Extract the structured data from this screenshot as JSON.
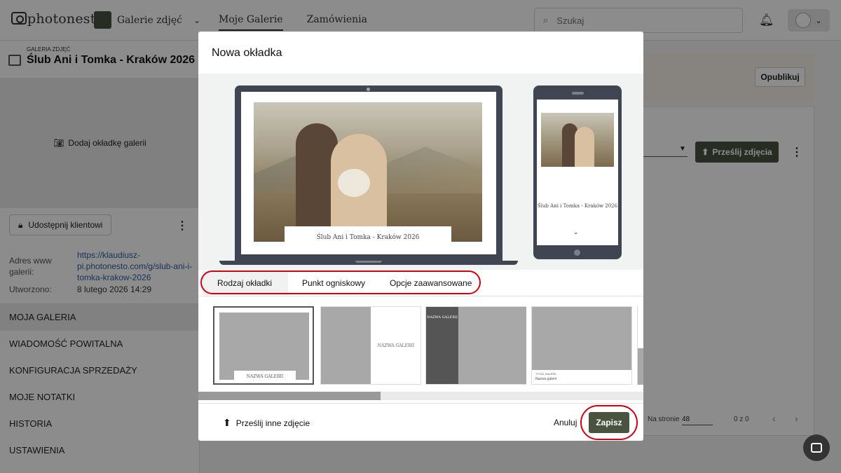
{
  "app": {
    "logo_text": "photonesto",
    "gallery_switch_label": "Galerie zdjęć",
    "nav": [
      "Moje Galerie",
      "Zamówienia"
    ],
    "search_placeholder": "Szukaj"
  },
  "sidebar": {
    "eyebrow": "GALERIA ZDJĘĆ",
    "title": "Ślub Ani i Tomka - Kraków 2026",
    "add_cover_label": "Dodaj okładkę galerii",
    "share_label": "Udostępnij klientowi",
    "address_label": "Adres www galerii:",
    "address_value": "https://klaudiusz-pi.photonesto.com/g/slub-ani-i-tomka-krakow-2026",
    "created_label": "Utworzono:",
    "created_value": "8 lutego 2026 14:29",
    "menu": [
      "MOJA GALERIA",
      "WIADOMOŚĆ POWITALNA",
      "KONFIGURACJA SPRZEDAŻY",
      "MOJE NOTATKI",
      "HISTORIA",
      "USTAWIENIA"
    ]
  },
  "content": {
    "publish_label": "Opublikuj",
    "upload_label": "Prześlij zdjęcia",
    "per_page_label": "Na stronie",
    "per_page_value": "48",
    "count_label": "0 z 0"
  },
  "modal": {
    "title": "Nowa okładka",
    "cover_caption": "Ślub Ani i Tomka - Kraków 2026",
    "tabs": [
      "Rodzaj okładki",
      "Punkt ogniskowy",
      "Opcje zaawansowane"
    ],
    "thumb_label": "NAZWA GALERII",
    "thumb_small_label": "TYTUŁ GALERII",
    "thumb_small_name": "Nazwa galerii",
    "upload_other_label": "Prześlij inne zdjęcie",
    "cancel_label": "Anuluj",
    "save_label": "Zapisz"
  },
  "colors": {
    "accent": "#4a5240",
    "highlight": "#d40010"
  }
}
